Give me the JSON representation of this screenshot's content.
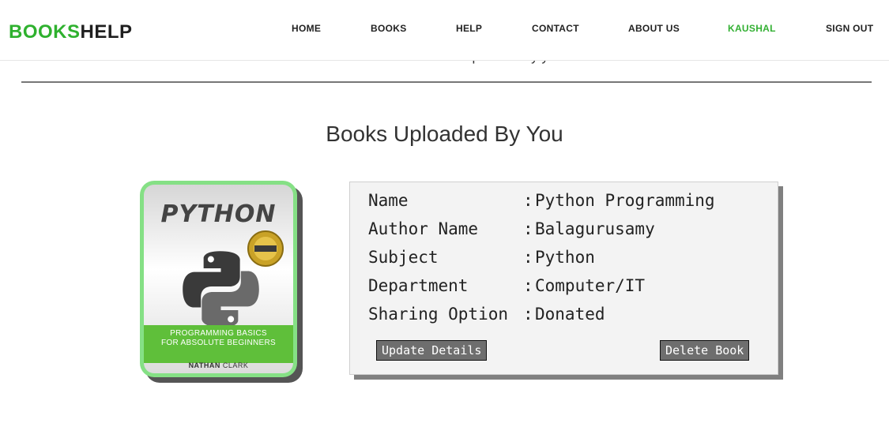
{
  "header": {
    "logo_part1": "BOOKS",
    "logo_part2": "HELP",
    "nav": [
      "HOME",
      "BOOKS",
      "HELP",
      "CONTACT",
      "ABOUT US",
      "KAUSHAL",
      "SIGN OUT"
    ],
    "active_color": "#33b033",
    "logo_color": "#2fb12f"
  },
  "info_text": "The users which are interested in the book uploaded by you will be shown here.",
  "section_title": "Books Uploaded By You",
  "book": {
    "cover": {
      "title": "PYTHON",
      "subtitle_line1": "PROGRAMMING BASICS",
      "subtitle_line2": "FOR ABSOLUTE BEGINNERS",
      "author_first": "NATHAN",
      "author_last": "CLARK",
      "badge_icon": "step-by-step-guide-badge",
      "logo_icon": "python-logo-icon"
    },
    "details": [
      {
        "label": "Name",
        "value": "Python Programming"
      },
      {
        "label": "Author Name",
        "value": "Balagurusamy"
      },
      {
        "label": "Subject",
        "value": "Python"
      },
      {
        "label": "Department",
        "value": "Computer/IT"
      },
      {
        "label": "Sharing Option",
        "value": "Donated"
      }
    ],
    "separator": ":",
    "update_button": "Update Details",
    "delete_button": "Delete Book"
  }
}
